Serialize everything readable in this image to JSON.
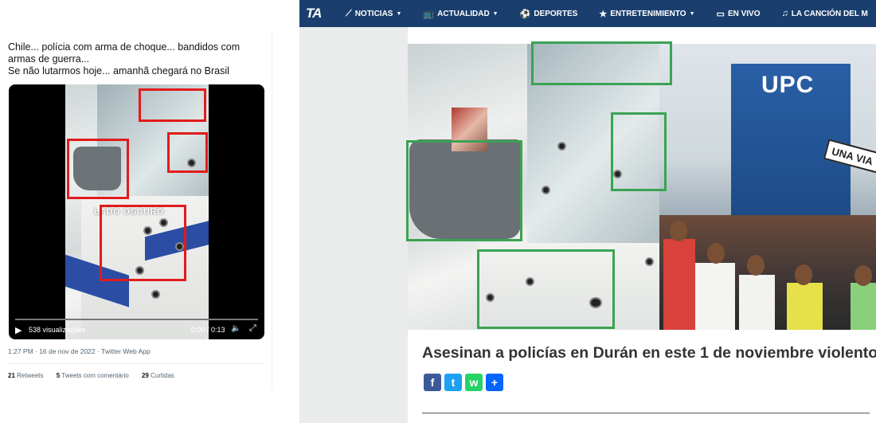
{
  "tweet": {
    "text_lines": [
      "Chile... polícia com arma de choque... bandidos com armas de guerra...",
      "Se não lutarmos hoje... amanhã chegará no Brasil"
    ],
    "video": {
      "watermark": "LADO OSCURO",
      "views": "538 visualizações",
      "time": "0:00 / 0:13",
      "progress": 0
    },
    "meta": "1:27 PM · 16 de nov de 2022 · Twitter Web App",
    "stats": [
      {
        "count": "21",
        "label": "Retweets"
      },
      {
        "count": "5",
        "label": "Tweets com comentário"
      },
      {
        "count": "29",
        "label": "Curtidas"
      }
    ]
  },
  "site": {
    "logo": "TA",
    "nav": [
      {
        "icon": "signal-icon",
        "glyph": "⟋",
        "label": "NOTICIAS",
        "dropdown": true
      },
      {
        "icon": "tv-retro-icon",
        "glyph": "📺",
        "label": "ACTUALIDAD",
        "dropdown": true
      },
      {
        "icon": "soccer-ball-icon",
        "glyph": "⚽",
        "label": "DEPORTES",
        "dropdown": false
      },
      {
        "icon": "star-icon",
        "glyph": "★",
        "label": "ENTRETENIMIENTO",
        "dropdown": true
      },
      {
        "icon": "monitor-icon",
        "glyph": "▭",
        "label": "EN VIVO",
        "dropdown": false
      },
      {
        "icon": "music-note-icon",
        "glyph": "♫",
        "label": "LA CANCIÓN DEL M",
        "dropdown": false
      }
    ],
    "photo_text": {
      "building": "UPC",
      "street_sign": "UNA VIA"
    },
    "headline": "Asesinan a policías en Durán en este 1 de noviembre violento",
    "share": [
      {
        "name": "facebook",
        "glyph": "f",
        "color": "#3b5998"
      },
      {
        "name": "twitter",
        "glyph": "t",
        "color": "#1da1f2"
      },
      {
        "name": "whatsapp",
        "glyph": "w",
        "color": "#25d366"
      },
      {
        "name": "share-more",
        "glyph": "+",
        "color": "#0166ff"
      }
    ]
  },
  "colors": {
    "nav_bg": "#1a3f6e",
    "annotation_red": "#e21b1b",
    "annotation_green": "#3aa354"
  }
}
